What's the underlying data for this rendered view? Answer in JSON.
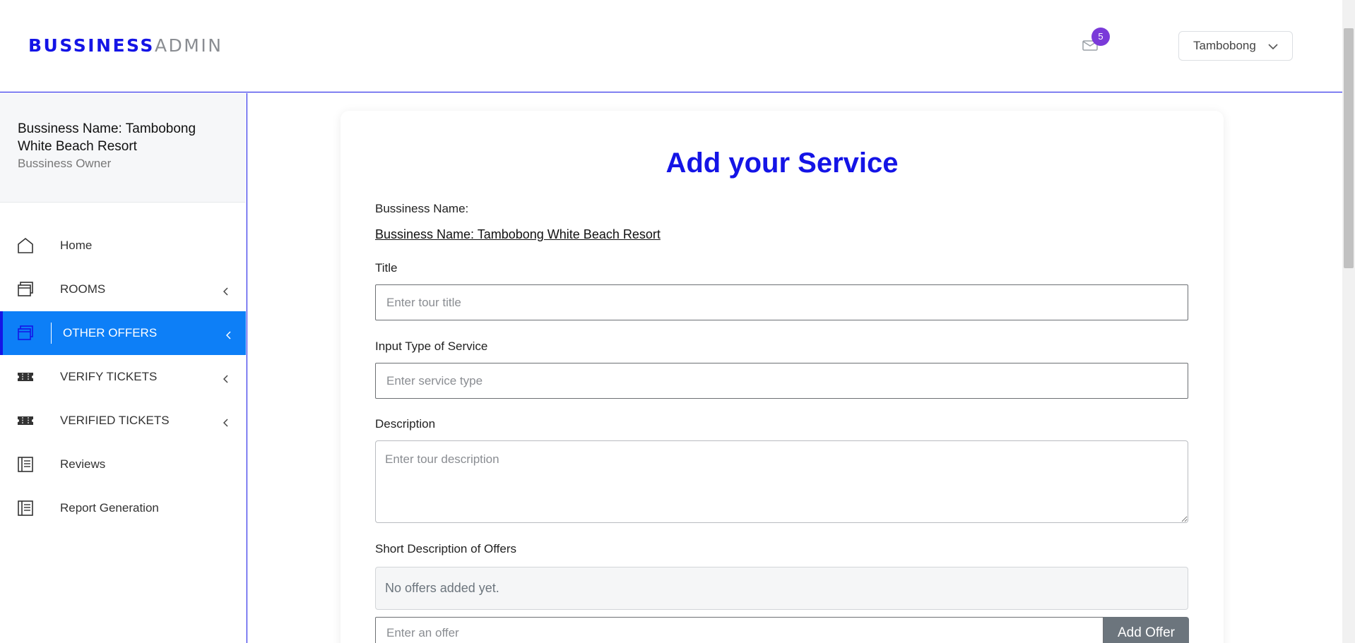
{
  "header": {
    "logo_part1": "BUSSINESS",
    "logo_part2": "ADMIN",
    "notification_count": "5",
    "user_menu_label": "Tambobong"
  },
  "sidebar": {
    "profile_name": "Bussiness Name: Tambobong White Beach Resort",
    "profile_role": "Bussiness Owner",
    "items": [
      {
        "label": "Home",
        "icon": "home-icon",
        "has_submenu": false,
        "active": false
      },
      {
        "label": "ROOMS",
        "icon": "window-icon",
        "has_submenu": true,
        "active": false
      },
      {
        "label": "OTHER OFFERS",
        "icon": "window-icon",
        "has_submenu": true,
        "active": true
      },
      {
        "label": "VERIFY TICKETS",
        "icon": "ticket-icon",
        "has_submenu": true,
        "active": false
      },
      {
        "label": "VERIFIED TICKETS",
        "icon": "ticket-icon",
        "has_submenu": true,
        "active": false
      },
      {
        "label": "Reviews",
        "icon": "list-icon",
        "has_submenu": false,
        "active": false
      },
      {
        "label": "Report Generation",
        "icon": "list-icon",
        "has_submenu": false,
        "active": false
      }
    ]
  },
  "form": {
    "title": "Add your Service",
    "business_label": "Bussiness Name:",
    "business_value": "Bussiness Name: Tambobong White Beach Resort",
    "title_label": "Title",
    "title_placeholder": "Enter tour title",
    "service_type_label": "Input Type of Service",
    "service_type_placeholder": "Enter service type",
    "description_label": "Description",
    "description_placeholder": "Enter tour description",
    "offers_label": "Short Description of Offers",
    "offers_empty": "No offers added yet.",
    "offer_placeholder": "Enter an offer",
    "add_offer_label": "Add Offer"
  },
  "colors": {
    "brand_blue": "#1414e6",
    "active_nav": "#0d7ff7",
    "badge": "#7a3ad9",
    "button_gray": "#6c757d"
  }
}
